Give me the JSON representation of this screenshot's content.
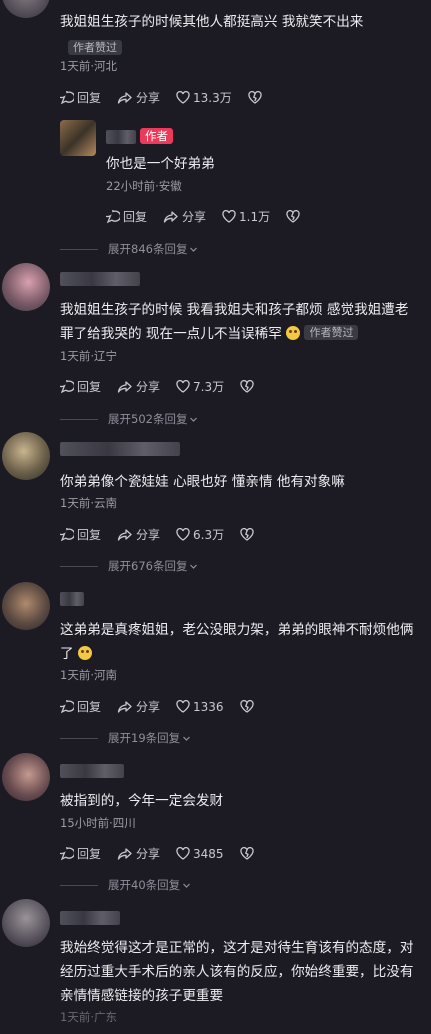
{
  "labels": {
    "reply": "回复",
    "share": "分享",
    "author_liked": "作者赞过",
    "author_tag": "作者"
  },
  "comments": [
    {
      "text": "我姐姐生孩子的时候其他人都挺高兴  我就笑不出来",
      "meta": "1天前·河北",
      "likes": "13.3万",
      "expand": ""
    },
    {
      "text": "你也是一个好弟弟",
      "meta": "22小时前·安徽",
      "likes": "1.1万",
      "expand": "展开846条回复"
    },
    {
      "text": "我姐姐生孩子的时候 我看我姐夫和孩子都烦 感觉我姐遭老罪了给我哭的 现在一点儿不当误稀罕",
      "meta": "1天前·辽宁",
      "likes": "7.3万",
      "expand": "展开502条回复"
    },
    {
      "text": "你弟弟像个瓷娃娃 心眼也好 懂亲情 他有对象嘛",
      "meta": "1天前·云南",
      "likes": "6.3万",
      "expand": "展开676条回复"
    },
    {
      "text": "这弟弟是真疼姐姐，老公没眼力架，弟弟的眼神不耐烦他俩了",
      "meta": "1天前·河南",
      "likes": "1336",
      "expand": "展开19条回复"
    },
    {
      "text": "被指到的，今年一定会发财",
      "meta": "15小时前·四川",
      "likes": "3485",
      "expand": "展开40条回复"
    },
    {
      "text": "我始终觉得这才是正常的，这才是对待生育该有的态度，对经历过重大手术后的亲人该有的反应，你始终重要，比没有亲情情感链接的孩子更重要",
      "meta": "1天前·广东",
      "likes": "",
      "expand": ""
    }
  ],
  "colors": {
    "background": "#1c1b24",
    "author_tag": "#ec3a5a",
    "badge": "#3a3a44"
  }
}
